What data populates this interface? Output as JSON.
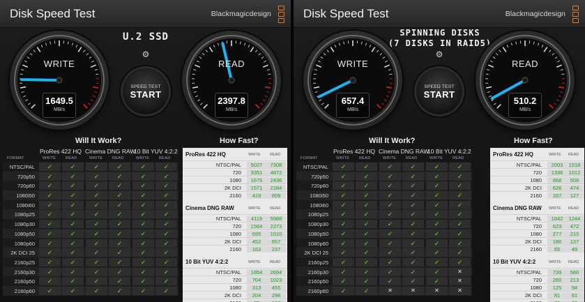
{
  "brand": "Blackmagicdesign",
  "app_title": "Disk Speed Test",
  "icons": {
    "gear": "gear-icon",
    "check": "✓",
    "cross": "✕"
  },
  "colors": {
    "needle": "#1eb4f0",
    "check": "#6de03a",
    "redline": "#e02020",
    "fast_value": "#189a18"
  },
  "start_button": {
    "small": "SPEED TEST",
    "big": "START"
  },
  "unit": "MB/s",
  "will_title": "Will It Work?",
  "how_title": "How Fast?",
  "format_header": "FORMAT",
  "write_header": "WRITE",
  "read_header": "READ",
  "codecs": [
    "ProRes 422 HQ",
    "Cinema DNG RAW",
    "10 Bit YUV 4:2:2"
  ],
  "formats": [
    "NTSC/PAL",
    "720p50",
    "720p60",
    "1080i50",
    "1080i60",
    "1080p25",
    "1080p30",
    "1080p50",
    "1080p60",
    "2K DCI 25",
    "2160p25",
    "2160p30",
    "2160p50",
    "2160p60"
  ],
  "panels": [
    {
      "drive_label": "U.2 SSD",
      "write": {
        "label": "WRITE",
        "value": "1649.5",
        "fraction": 0.17
      },
      "read": {
        "label": "READ",
        "value": "2397.8",
        "fraction": 0.45
      },
      "will": [
        [
          1,
          1,
          1,
          1,
          1,
          1
        ],
        [
          1,
          1,
          1,
          1,
          1,
          1
        ],
        [
          1,
          1,
          1,
          1,
          1,
          1
        ],
        [
          1,
          1,
          1,
          1,
          1,
          1
        ],
        [
          1,
          1,
          1,
          1,
          1,
          1
        ],
        [
          1,
          1,
          1,
          1,
          1,
          1
        ],
        [
          1,
          1,
          1,
          1,
          1,
          1
        ],
        [
          1,
          1,
          1,
          1,
          1,
          1
        ],
        [
          1,
          1,
          1,
          1,
          1,
          1
        ],
        [
          1,
          1,
          1,
          1,
          1,
          1
        ],
        [
          1,
          1,
          1,
          1,
          1,
          1
        ],
        [
          1,
          1,
          1,
          1,
          1,
          1
        ],
        [
          1,
          1,
          1,
          1,
          1,
          1
        ],
        [
          1,
          1,
          1,
          1,
          1,
          1
        ]
      ],
      "how": [
        {
          "name": "ProRes 422 HQ",
          "rows": [
            [
              "NTSC/PAL",
              "5027",
              "7308"
            ],
            [
              "720",
              "3351",
              "4872"
            ],
            [
              "1080",
              "1676",
              "2436"
            ],
            [
              "2K DCI",
              "1571",
              "2284"
            ],
            [
              "2160",
              "419",
              "609"
            ]
          ]
        },
        {
          "name": "Cinema DNG RAW",
          "rows": [
            [
              "NTSC/PAL",
              "4119",
              "5988"
            ],
            [
              "720",
              "1564",
              "2273"
            ],
            [
              "1080",
              "695",
              "1010"
            ],
            [
              "2K DCI",
              "452",
              "657"
            ],
            [
              "2160",
              "163",
              "237"
            ]
          ]
        },
        {
          "name": "10 Bit YUV 4:2:2",
          "rows": [
            [
              "NTSC/PAL",
              "1854",
              "2694"
            ],
            [
              "720",
              "704",
              "1023"
            ],
            [
              "1080",
              "313",
              "455"
            ],
            [
              "2K DCI",
              "204",
              "296"
            ],
            [
              "2160",
              "73",
              "107"
            ]
          ]
        }
      ]
    },
    {
      "drive_label": "SPINNING DISKS\n(7 DISKS IN RAID5)",
      "write": {
        "label": "WRITE",
        "value": "657.4",
        "fraction": 0.07
      },
      "read": {
        "label": "READ",
        "value": "510.2",
        "fraction": 0.06
      },
      "will": [
        [
          1,
          1,
          1,
          1,
          1,
          1
        ],
        [
          1,
          1,
          1,
          1,
          1,
          1
        ],
        [
          1,
          1,
          1,
          1,
          1,
          1
        ],
        [
          1,
          1,
          1,
          1,
          1,
          1
        ],
        [
          1,
          1,
          1,
          1,
          1,
          1
        ],
        [
          1,
          1,
          1,
          1,
          1,
          1
        ],
        [
          1,
          1,
          1,
          1,
          1,
          1
        ],
        [
          1,
          1,
          1,
          1,
          1,
          1
        ],
        [
          1,
          1,
          1,
          1,
          1,
          1
        ],
        [
          1,
          1,
          1,
          1,
          1,
          1
        ],
        [
          1,
          1,
          1,
          1,
          1,
          1
        ],
        [
          1,
          1,
          1,
          1,
          1,
          0
        ],
        [
          1,
          1,
          1,
          1,
          1,
          0
        ],
        [
          1,
          1,
          0,
          0,
          0,
          0
        ]
      ],
      "how": [
        {
          "name": "ProRes 422 HQ",
          "rows": [
            [
              "NTSC/PAL",
              "2003",
              "1518"
            ],
            [
              "720",
              "1336",
              "1012"
            ],
            [
              "1080",
              "668",
              "506"
            ],
            [
              "2K DCI",
              "626",
              "474"
            ],
            [
              "2160",
              "167",
              "127"
            ]
          ]
        },
        {
          "name": "Cinema DNG RAW",
          "rows": [
            [
              "NTSC/PAL",
              "1642",
              "1244"
            ],
            [
              "720",
              "623",
              "472"
            ],
            [
              "1080",
              "277",
              "210"
            ],
            [
              "2K DCI",
              "180",
              "137"
            ],
            [
              "2160",
              "65",
              "49"
            ]
          ]
        },
        {
          "name": "10 Bit YUV 4:2:2",
          "rows": [
            [
              "NTSC/PAL",
              "739",
              "560"
            ],
            [
              "720",
              "280",
              "213"
            ],
            [
              "1080",
              "125",
              "94"
            ],
            [
              "2K DCI",
              "81",
              "61"
            ],
            [
              "2160",
              "29",
              "22"
            ]
          ]
        }
      ]
    }
  ]
}
